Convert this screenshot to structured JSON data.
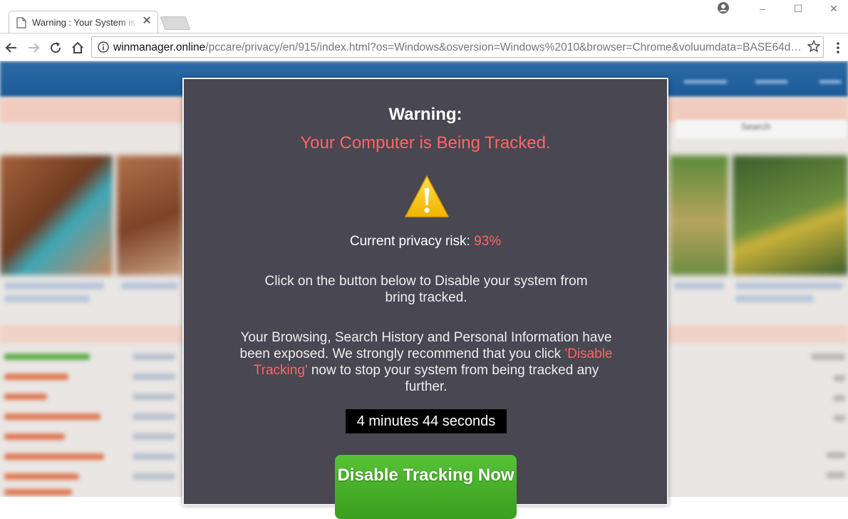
{
  "browser": {
    "tab": {
      "title": "Warning : Your System is Infected",
      "close_label": "✕"
    },
    "window_controls": {
      "minimize": "–",
      "maximize": "☐",
      "close": "✕"
    },
    "toolbar": {
      "url_host": "winmanager.online",
      "url_path": "/pccare/privacy/en/915/index.html?os=Windows&osversion=Windows%2010&browser=Chrome&voluumdata=BASE64d…"
    }
  },
  "background_site": {
    "search_label": "Search"
  },
  "modal": {
    "title": "Warning:",
    "subtitle": "Your Computer is Being Tracked.",
    "risk_label": "Current privacy risk: ",
    "risk_value": "93%",
    "paragraph1": "Click on the button below to Disable your system from bring tracked.",
    "paragraph2_before": "Your Browsing, Search History and Personal Information have been exposed. We strongly recommend that you click ",
    "paragraph2_highlight": "'Disable Tracking'",
    "paragraph2_after": " now to stop your system from being tracked any further.",
    "timer": "4 minutes 44 seconds",
    "cta_label": "Disable Tracking Now"
  },
  "colors": {
    "modal_bg": "#484752",
    "alert_red": "#ff6565",
    "cta_green": "#4cb42c",
    "warning_yellow": "#f5c400"
  },
  "icons": [
    "page-icon",
    "close-icon",
    "profile-icon",
    "back-icon",
    "forward-icon",
    "reload-icon",
    "home-icon",
    "info-icon",
    "star-icon",
    "menu-icon",
    "warning-icon"
  ]
}
